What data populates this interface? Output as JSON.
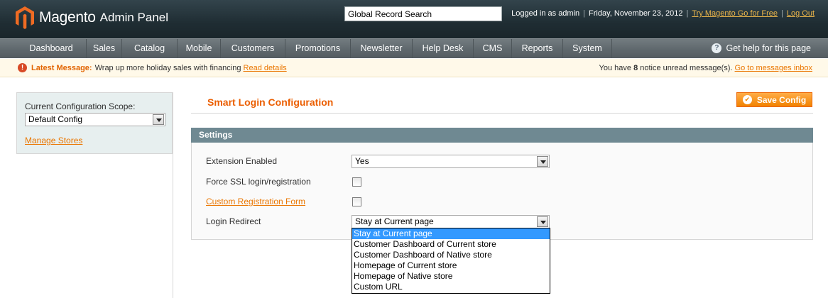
{
  "header": {
    "brand": "Magento",
    "brand_sub": "Admin Panel",
    "search_value": "Global Record Search",
    "logged_in": "Logged in as admin",
    "date": "Friday, November 23, 2012",
    "try_link": "Try Magento Go for Free",
    "logout": "Log Out"
  },
  "nav": {
    "items": [
      "Dashboard",
      "Sales",
      "Catalog",
      "Mobile",
      "Customers",
      "Promotions",
      "Newsletter",
      "Help Desk",
      "CMS",
      "Reports",
      "System"
    ],
    "help": "Get help for this page"
  },
  "notice": {
    "title": "Latest Message:",
    "message": "Wrap up more holiday sales with financing",
    "read_details": "Read details",
    "count_prefix": "You have",
    "count": "8",
    "count_suffix": "notice unread message(s).",
    "inbox_link": "Go to messages inbox"
  },
  "sidebar": {
    "scope_label": "Current Configuration Scope:",
    "scope_value": "Default Config",
    "manage_stores": "Manage Stores"
  },
  "main": {
    "title": "Smart Login Configuration",
    "save_label": "Save Config",
    "fieldset_title": "Settings",
    "fields": {
      "extension_enabled": {
        "label": "Extension Enabled",
        "value": "Yes"
      },
      "force_ssl": {
        "label": "Force SSL login/registration",
        "checked": false
      },
      "custom_registration": {
        "label": "Custom Registration Form",
        "checked": false
      },
      "login_redirect": {
        "label": "Login Redirect",
        "value": "Stay at Current page",
        "options": [
          "Stay at Current page",
          "Customer Dashboard of Current store",
          "Customer Dashboard of Native store",
          "Homepage of Current store",
          "Homepage of Native store",
          "Custom URL"
        ],
        "highlighted_index": 0
      }
    }
  },
  "colors": {
    "accent": "#eb5e00",
    "link": "#ea7601",
    "header_bg": "#1f2d33",
    "nav_bg": "#5f686d",
    "fieldset_head": "#6f8992",
    "selection": "#3399ff"
  },
  "icons": {
    "logo": "magento-logo-icon",
    "help": "help-icon",
    "notice": "alert-icon",
    "save": "ok-icon",
    "dropdown": "chevron-down-icon"
  }
}
